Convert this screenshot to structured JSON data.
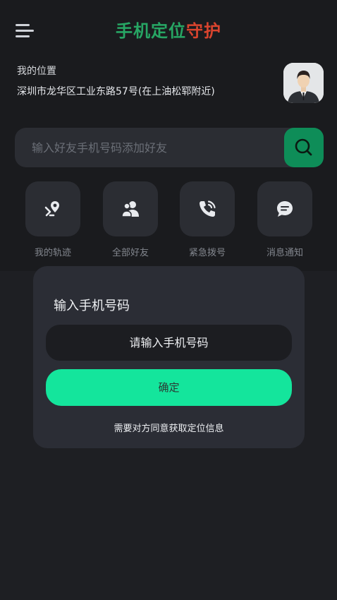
{
  "header": {
    "title_part1": "手机定位",
    "title_part2": "守护",
    "title_part1_color": "#27a664",
    "title_part2_color": "#d9442e"
  },
  "location": {
    "label": "我的位置",
    "address": "深圳市龙华区工业东路57号(在上油松郓附近)"
  },
  "search": {
    "placeholder": "输入好友手机号码添加好友",
    "button_color": "#0e8d58"
  },
  "actions": [
    {
      "label": "我的轨迹",
      "icon": "route-icon"
    },
    {
      "label": "全部好友",
      "icon": "friends-icon"
    },
    {
      "label": "紧急拨号",
      "icon": "phone-icon"
    },
    {
      "label": "消息通知",
      "icon": "message-icon"
    }
  ],
  "dialog": {
    "title": "输入手机号码",
    "input_placeholder": "请输入手机号码",
    "confirm_label": "确定",
    "note": "需要对方同意获取定位信息",
    "confirm_color": "#14e59c"
  }
}
